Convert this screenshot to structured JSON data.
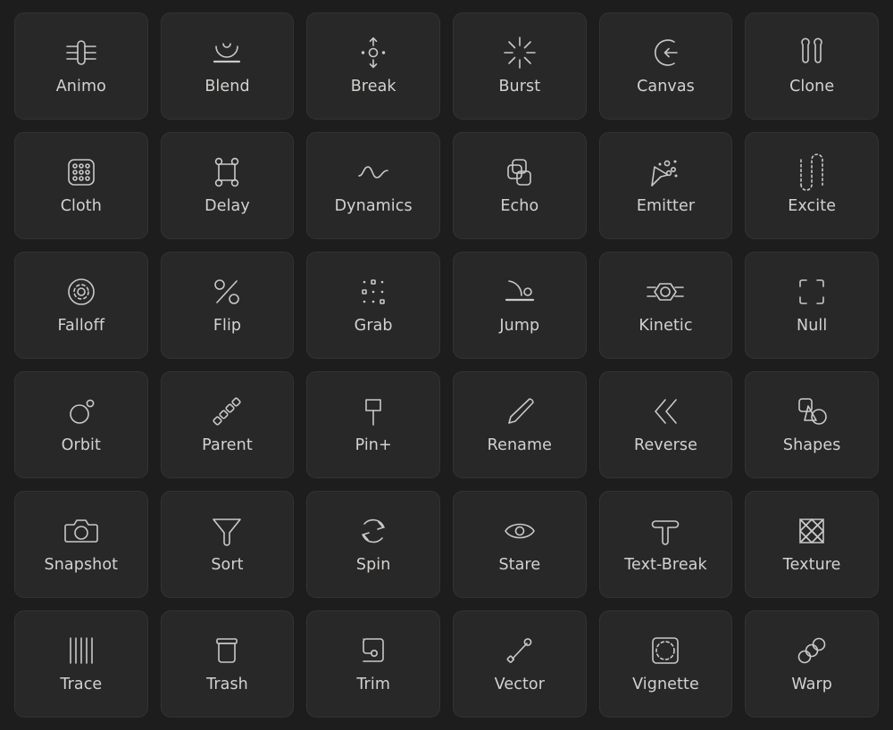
{
  "palette": {
    "page_background": "#1d1d1d",
    "card_background": "#282828",
    "card_border": "#333333",
    "icon_stroke": "#c9c9c9",
    "label_color": "#d4d2d0"
  },
  "grid": {
    "columns": 6,
    "rows": 6,
    "total_items": 36
  },
  "items": [
    {
      "label": "Animo",
      "icon": "chip-capsule-icon"
    },
    {
      "label": "Blend",
      "icon": "bowl-arc-over-line-icon"
    },
    {
      "label": "Break",
      "icon": "circle-up-down-arrows-icon"
    },
    {
      "label": "Burst",
      "icon": "starburst-rays-icon"
    },
    {
      "label": "Canvas",
      "icon": "circle-arrow-inward-icon"
    },
    {
      "label": "Clone",
      "icon": "two-pin-capsules-icon"
    },
    {
      "label": "Cloth",
      "icon": "rounded-square-dot-grid-icon"
    },
    {
      "label": "Delay",
      "icon": "square-corner-nodes-icon"
    },
    {
      "label": "Dynamics",
      "icon": "sine-wave-icon"
    },
    {
      "label": "Echo",
      "icon": "stacked-squares-icon"
    },
    {
      "label": "Emitter",
      "icon": "cursor-sparkles-icon"
    },
    {
      "label": "Excite",
      "icon": "dashed-serpentine-icon"
    },
    {
      "label": "Falloff",
      "icon": "concentric-dashed-circles-icon"
    },
    {
      "label": "Flip",
      "icon": "percent-icon"
    },
    {
      "label": "Grab",
      "icon": "scatter-dots-icon"
    },
    {
      "label": "Jump",
      "icon": "arc-to-circle-over-line-icon"
    },
    {
      "label": "Kinetic",
      "icon": "hex-circle-motion-lines-icon"
    },
    {
      "label": "Null",
      "icon": "dashed-crop-corners-icon"
    },
    {
      "label": "Orbit",
      "icon": "circle-with-satellite-icon"
    },
    {
      "label": "Parent",
      "icon": "diagonal-chain-squares-icon"
    },
    {
      "label": "Pin+",
      "icon": "push-pin-icon"
    },
    {
      "label": "Rename",
      "icon": "pencil-icon"
    },
    {
      "label": "Reverse",
      "icon": "double-chevron-left-icon"
    },
    {
      "label": "Shapes",
      "icon": "square-triangle-circle-icon"
    },
    {
      "label": "Snapshot",
      "icon": "camera-icon"
    },
    {
      "label": "Sort",
      "icon": "funnel-icon"
    },
    {
      "label": "Spin",
      "icon": "circular-arrows-icon"
    },
    {
      "label": "Stare",
      "icon": "eye-icon"
    },
    {
      "label": "Text-Break",
      "icon": "letter-t-outline-icon"
    },
    {
      "label": "Texture",
      "icon": "cross-hatch-square-icon"
    },
    {
      "label": "Trace",
      "icon": "tally-bars-icon"
    },
    {
      "label": "Trash",
      "icon": "trash-bin-icon"
    },
    {
      "label": "Trim",
      "icon": "rounded-rect-cut-node-icon"
    },
    {
      "label": "Vector",
      "icon": "line-with-endpoints-icon"
    },
    {
      "label": "Vignette",
      "icon": "square-dashed-circle-icon"
    },
    {
      "label": "Warp",
      "icon": "linked-rings-icon"
    }
  ]
}
